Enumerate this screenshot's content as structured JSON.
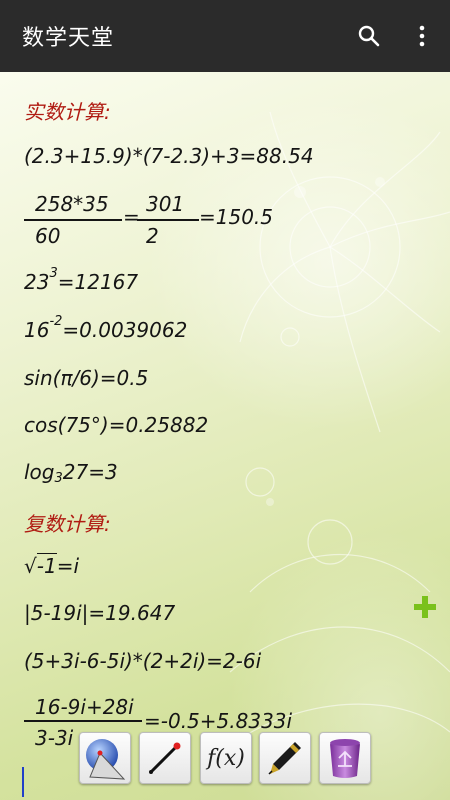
{
  "app": {
    "title": "数学天堂",
    "actions": [
      "search-icon",
      "more-vertical-icon"
    ]
  },
  "sections": {
    "real": {
      "heading": "实数计算:",
      "expr1": "(2.3+15.9)*(7-2.3)+3=88.54",
      "expr2": {
        "left_num": "258*35",
        "left_den": "60",
        "eq": "=",
        "right_num": "301",
        "right_den": "2",
        "result": "=150.5"
      },
      "expr3": {
        "base": "23",
        "exp": "3",
        "result": "=12167"
      },
      "expr4": {
        "base": "16",
        "exp": "-2",
        "result": "=0.0039062"
      },
      "expr5": "sin(π/6)=0.5",
      "expr6": "cos(75°)=0.25882",
      "expr7": {
        "prefix": "log",
        "base": "3",
        "arg_result": "27=3"
      }
    },
    "complex": {
      "heading": "复数计算:",
      "expr1": {
        "root": "√",
        "radicand": "-1",
        "result": "=i"
      },
      "expr2": "|5-19i|=19.647",
      "expr3": "(5+3i-6-5i)*(2+2i)=2-6i",
      "expr4": {
        "num": "16-9i+28i",
        "den": "3-3i",
        "result": "=-0.5+5.8333i"
      }
    }
  },
  "tools": [
    "geometry-icon",
    "line-segment-icon",
    "function-fx-icon",
    "pen-icon",
    "trash-icon"
  ],
  "tool_labels": {
    "function": "f(x)"
  },
  "colors": {
    "appbar": "#2b2b2b",
    "heading": "#b01b12",
    "text": "#151515",
    "accent_plus": "#7ac11c",
    "background": "#e3ecbc"
  }
}
